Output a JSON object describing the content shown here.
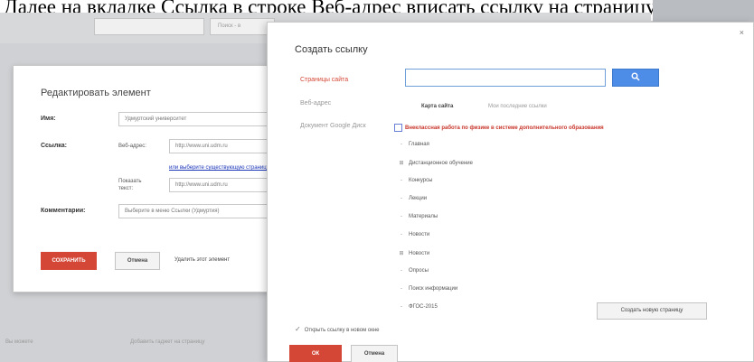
{
  "caption": "Далее на вкладке Ссылка в строке Веб-адрес вписать ссылку на страницу",
  "background": {
    "search_hint": "Поиск - в",
    "bottom_left": "Вы можете",
    "bottom_mid": "Добавить гаджет на страницу"
  },
  "edit_dialog": {
    "title": "Редактировать элемент",
    "name_label": "Имя:",
    "name_value": "Удмуртский университет",
    "link_label": "Ссылка:",
    "url_label": "Веб-адрес:",
    "url_value": "http://www.uni.udm.ru",
    "choose_link": "или выберите существующую страницу",
    "show_text_label": "Показать текст:",
    "show_text_value": "http://www.uni.udm.ru",
    "comment_label": "Комментарии:",
    "comment_value": "Выберите в меню Ссылки (Удмуртия)",
    "save": "СОХРАНИТЬ",
    "cancel": "Отмена",
    "delete": "Удалить этот элемент"
  },
  "link_dialog": {
    "close": "×",
    "title": "Создать ссылку",
    "sidebar": {
      "site_pages": "Страницы сайта",
      "web_address": "Веб-адрес",
      "google_drive": "Документ Google Диск"
    },
    "search_placeholder": "",
    "search_icon": "search-icon",
    "tabs": {
      "site_map": "Карта сайта",
      "recent": "Мои последние ссылки"
    },
    "tree_root": "Внеклассная работа по физике в системе дополнительного образования",
    "tree_items": [
      {
        "prefix": "-",
        "label": "Главная"
      },
      {
        "prefix": "⊞",
        "label": "Дистанционное обучение"
      },
      {
        "prefix": "-",
        "label": "Конкурсы"
      },
      {
        "prefix": "-",
        "label": "Лекции"
      },
      {
        "prefix": "-",
        "label": "Материалы"
      },
      {
        "prefix": "-",
        "label": "Новости"
      },
      {
        "prefix": "⊞",
        "label": "Новости"
      },
      {
        "prefix": "-",
        "label": "Опросы"
      },
      {
        "prefix": "-",
        "label": "Поиск информации"
      },
      {
        "prefix": "-",
        "label": "ФГОС-2015"
      }
    ],
    "new_page_button": "Создать новую страницу",
    "new_window_check": "✓",
    "new_window_label": "Открыть ссылку в новом окне",
    "ok": "ОК",
    "cancel": "Отмена"
  }
}
